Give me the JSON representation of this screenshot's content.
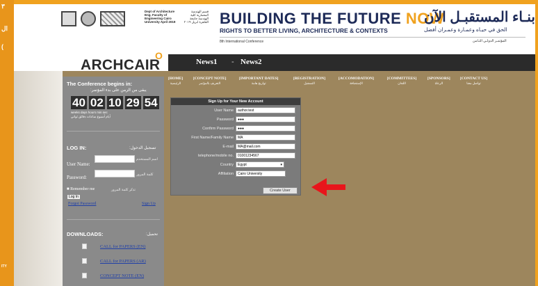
{
  "strip": {
    "l1": "۳",
    "l2": "ال",
    "l3": "(",
    "l4": "ITY"
  },
  "header": {
    "uni_en": "Dept of Architecture Eng. Faculty of Engineering Cairo University April 2019",
    "uni_ar": "قسم الهندسة المعمارية كلية الهندسة جامعة القاهرة ابريل ٢٠١٩",
    "title_main": "BUILDING THE FUTURE ",
    "title_now": "NOW",
    "title_sub": "RIGHTS TO BETTER LIVING, ARCHITECTURE & CONTEXTS",
    "title_conf": "8th International Conference",
    "ar_main": "بنـاء المستقبـل الآن",
    "ar_sub": "الحق في حيـاه وعمـارة وعمـران أفضل",
    "ar_conf": "المؤتمـر الدولـي الثـامن"
  },
  "brand": {
    "name": "ARCHCAIR",
    "suffix": "O"
  },
  "nav": {
    "news1": "News1",
    "sep": "-",
    "news2": "News2"
  },
  "sidebar": {
    "conf_begins": "The Conference begins in:",
    "conf_begins_ar": "يبقى من الزمن على بدء المؤتمر:",
    "digits": [
      "40",
      "02",
      "10",
      "29",
      "54"
    ],
    "digit_labels": "weeks days hours min sec",
    "digit_labels_ar": "أيام أسبوع   ساعات دقائق   ثواني",
    "login_title": "LOG IN:",
    "login_title_ar": "تسجيل الدخول:",
    "username_label": "User Name:",
    "username_ar": "اسم المستخدم",
    "password_label": "Password:",
    "password_ar": "كلمة المرور",
    "remember": "Remember me",
    "remember_ar": "تذكر كلمة المرور",
    "login_btn": "Log In",
    "forgot": "Forgot Password",
    "signup": "Sign Up",
    "downloads_title": "DOWNLOADS:",
    "downloads_ar": "تحميل:",
    "downloads": [
      "CALL for PAPERS (EN)",
      "CALL for PAPERS (AR)",
      "CONCEPT NOTE (EN)"
    ]
  },
  "menu": [
    {
      "en": "[HOME]",
      "ar": "الرئيسية"
    },
    {
      "en": "[CONCEPT NOTE]",
      "ar": "التعريف بالمؤتمر"
    },
    {
      "en": "[IMPORTANT DATES]",
      "ar": "تواريخ هامة"
    },
    {
      "en": "[REGISTRATION]",
      "ar": "التسجيل"
    },
    {
      "en": "[ACCOMODATION]",
      "ar": "الإستضافة"
    },
    {
      "en": "[COMMITTEES]",
      "ar": "اللجان"
    },
    {
      "en": "[SPONSORS]",
      "ar": "الرعاة"
    },
    {
      "en": "[CONTACT US]",
      "ar": "تواصل معنا"
    }
  ],
  "form": {
    "title": "Sign Up for Your New Account",
    "fields": [
      {
        "label": "User Name",
        "value": "author.test"
      },
      {
        "label": "Password",
        "value": "●●●"
      },
      {
        "label": "Confirm Password",
        "value": "●●●"
      },
      {
        "label": "First Name/Family Name",
        "value": "MA"
      },
      {
        "label": "E-mail",
        "value": "MA@mail.com"
      },
      {
        "label": "telephone/mobile no.",
        "value": "01001234567"
      }
    ],
    "country_label": "Country",
    "country_value": "Egypt",
    "affiliation_label": "Affiliation",
    "affiliation_value": "Cairo University",
    "create_button": "Create User"
  },
  "colors": {
    "accent": "#f0a21f",
    "navy": "#1d2a57",
    "body": "#9d865d",
    "arrow": "#e8151b"
  }
}
